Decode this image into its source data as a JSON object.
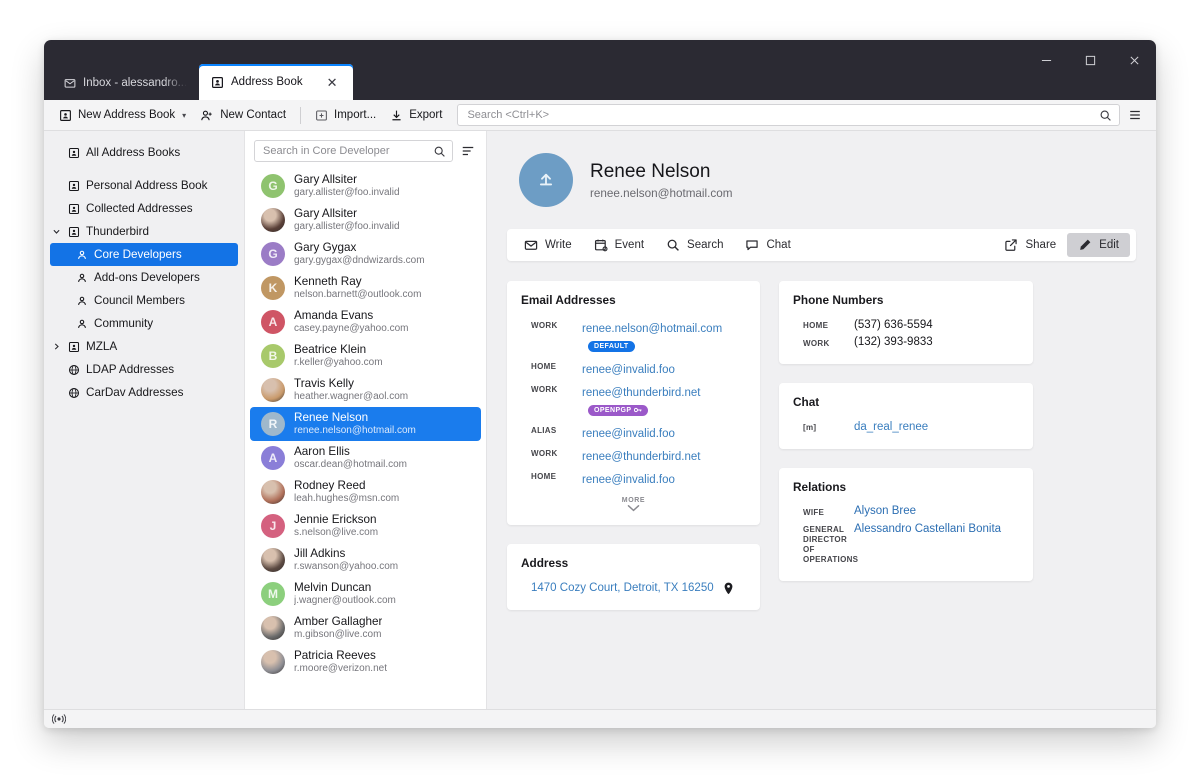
{
  "window": {
    "controls": {
      "minimize": "minimize-button",
      "maximize": "maximize-button",
      "close": "close-button"
    }
  },
  "tabs": [
    {
      "label": "Inbox - alessandro...",
      "icon": "mail-icon",
      "active": false,
      "closable": false
    },
    {
      "label": "Address Book",
      "icon": "address-book-icon",
      "active": true,
      "closable": true,
      "close_glyph": "✕"
    }
  ],
  "toolbar": {
    "new_address_book": "New Address Book",
    "new_address_book_caret": "▾",
    "new_contact": "New Contact",
    "import": "Import...",
    "export": "Export",
    "search_placeholder": "Search <Ctrl+K>",
    "menu": "app-menu-button"
  },
  "sidebar": {
    "items": [
      {
        "label": "All Address Books",
        "icon": "address-book-icon",
        "level": 0,
        "twisty": "",
        "selected": false,
        "gap": false
      },
      {
        "label": "Personal Address Book",
        "icon": "address-book-icon",
        "level": 0,
        "twisty": "",
        "selected": false,
        "gap": true
      },
      {
        "label": "Collected Addresses",
        "icon": "address-book-icon",
        "level": 0,
        "twisty": "",
        "selected": false,
        "gap": false
      },
      {
        "label": "Thunderbird",
        "icon": "address-book-icon",
        "level": 0,
        "twisty": "⌄",
        "selected": false,
        "gap": false
      },
      {
        "label": "Core Developers",
        "icon": "mailing-list-icon",
        "level": 1,
        "twisty": "",
        "selected": true,
        "gap": false
      },
      {
        "label": "Add-ons Developers",
        "icon": "mailing-list-icon",
        "level": 1,
        "twisty": "",
        "selected": false,
        "gap": false
      },
      {
        "label": "Council Members",
        "icon": "mailing-list-icon",
        "level": 1,
        "twisty": "",
        "selected": false,
        "gap": false
      },
      {
        "label": "Community",
        "icon": "mailing-list-icon",
        "level": 1,
        "twisty": "",
        "selected": false,
        "gap": false
      },
      {
        "label": "MZLA",
        "icon": "address-book-icon",
        "level": 0,
        "twisty": "›",
        "selected": false,
        "gap": false
      },
      {
        "label": "LDAP Addresses",
        "icon": "globe-icon",
        "level": 0,
        "twisty": "",
        "selected": false,
        "gap": false
      },
      {
        "label": "CarDav Addresses",
        "icon": "globe-icon",
        "level": 0,
        "twisty": "",
        "selected": false,
        "gap": false
      }
    ]
  },
  "contact_list": {
    "search_placeholder": "Search in Core Developer",
    "sort_button": "sort-options-button",
    "contacts": [
      {
        "name": "Gary Allsiter",
        "email": "gary.allister@foo.invalid",
        "initial": "G",
        "color": "#8fc36f",
        "photo": false,
        "selected": false
      },
      {
        "name": "Gary Allsiter",
        "email": "gary.allister@foo.invalid",
        "initial": "G",
        "color": "#5a4038",
        "photo": true,
        "selected": false
      },
      {
        "name": "Gary Gygax",
        "email": "gary.gygax@dndwizards.com",
        "initial": "G",
        "color": "#9b7cc6",
        "photo": false,
        "selected": false
      },
      {
        "name": "Kenneth Ray",
        "email": "nelson.barnett@outlook.com",
        "initial": "K",
        "color": "#c09763",
        "photo": false,
        "selected": false
      },
      {
        "name": "Amanda Evans",
        "email": "casey.payne@yahoo.com",
        "initial": "A",
        "color": "#cf5565",
        "photo": false,
        "selected": false
      },
      {
        "name": "Beatrice Klein",
        "email": "r.keller@yahoo.com",
        "initial": "B",
        "color": "#a8c96b",
        "photo": false,
        "selected": false
      },
      {
        "name": "Travis Kelly",
        "email": "heather.wagner@aol.com",
        "initial": "T",
        "color": "#c99a6b",
        "photo": true,
        "selected": false
      },
      {
        "name": "Renee Nelson",
        "email": "renee.nelson@hotmail.com",
        "initial": "R",
        "color": "#9fb8cc",
        "photo": false,
        "selected": true
      },
      {
        "name": "Aaron Ellis",
        "email": "oscar.dean@hotmail.com",
        "initial": "A",
        "color": "#8a7ed8",
        "photo": false,
        "selected": false
      },
      {
        "name": "Rodney Reed",
        "email": "leah.hughes@msn.com",
        "initial": "R",
        "color": "#b0705a",
        "photo": true,
        "selected": false
      },
      {
        "name": "Jennie Erickson",
        "email": "s.nelson@live.com",
        "initial": "J",
        "color": "#d4617f",
        "photo": false,
        "selected": false
      },
      {
        "name": "Jill Adkins",
        "email": "r.swanson@yahoo.com",
        "initial": "J",
        "color": "#5c4a42",
        "photo": true,
        "selected": false
      },
      {
        "name": "Melvin Duncan",
        "email": "j.wagner@outlook.com",
        "initial": "M",
        "color": "#8ccf7d",
        "photo": false,
        "selected": false
      },
      {
        "name": "Amber Gallagher",
        "email": "m.gibson@live.com",
        "initial": "A",
        "color": "#6b6b6b",
        "photo": true,
        "selected": false
      },
      {
        "name": "Patricia Reeves",
        "email": "r.moore@verizon.net",
        "initial": "P",
        "color": "#8d8d93",
        "photo": true,
        "selected": false
      }
    ]
  },
  "detail": {
    "avatar_icon": "upload-avatar-icon",
    "name": "Renee Nelson",
    "email": "renee.nelson@hotmail.com",
    "actions": [
      {
        "label": "Write",
        "icon": "envelope-icon",
        "pressed": false
      },
      {
        "label": "Event",
        "icon": "calendar-icon",
        "pressed": false
      },
      {
        "label": "Search",
        "icon": "search-icon",
        "pressed": false
      },
      {
        "label": "Chat",
        "icon": "chat-icon",
        "pressed": false
      }
    ],
    "actions_right": [
      {
        "label": "Share",
        "icon": "share-icon",
        "pressed": false
      },
      {
        "label": "Edit",
        "icon": "pencil-icon",
        "pressed": true
      }
    ],
    "email_card": {
      "title": "Email Addresses",
      "rows": [
        {
          "label": "Work",
          "value": "renee.nelson@hotmail.com",
          "badge": "DEFAULT",
          "badge_type": "default"
        },
        {
          "label": "Home",
          "value": "renee@invalid.foo",
          "badge": "",
          "badge_type": ""
        },
        {
          "label": "Work",
          "value": "renee@thunderbird.net",
          "badge": "OPENPGP",
          "badge_type": "openpgp"
        },
        {
          "label": "Alias",
          "value": "renee@invalid.foo",
          "badge": "",
          "badge_type": ""
        },
        {
          "label": "Work",
          "value": "renee@thunderbird.net",
          "badge": "",
          "badge_type": ""
        },
        {
          "label": "Home",
          "value": "renee@invalid.foo",
          "badge": "",
          "badge_type": ""
        }
      ],
      "more_label": "MORE",
      "more_icon": "chevron-down-icon"
    },
    "address_card": {
      "title": "Address",
      "value": "1470 Cozy Court, Detroit, TX 16250",
      "map_icon": "map-pin-icon"
    },
    "phone_card": {
      "title": "Phone Numbers",
      "rows": [
        {
          "label": "Home",
          "value": "(537) 636-5594"
        },
        {
          "label": "Work",
          "value": "(132) 393-9833"
        }
      ]
    },
    "chat_card": {
      "title": "Chat",
      "rows": [
        {
          "label": "[m]",
          "value": "da_real_renee"
        }
      ]
    },
    "relations_card": {
      "title": "Relations",
      "rows": [
        {
          "label": "Wife",
          "value": "Alyson Bree"
        },
        {
          "label": "General Director of Operations",
          "value": "Alessandro Castellani Bonita"
        }
      ]
    }
  },
  "statusbar": {
    "icon": "broadcast-icon"
  }
}
